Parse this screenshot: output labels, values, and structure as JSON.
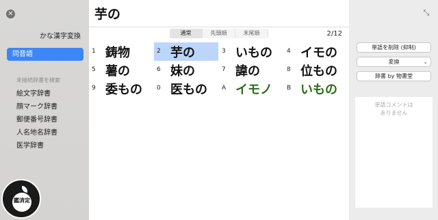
{
  "sidebar": {
    "title": "かな漢字変換",
    "selected_label": "同音語",
    "section_label": "未接続辞書を検索",
    "items": [
      {
        "label": "絵文字辞書"
      },
      {
        "label": "顔マーク辞書"
      },
      {
        "label": "郵便番号辞書"
      },
      {
        "label": "人名地名辞書"
      },
      {
        "label": "医学辞書"
      }
    ]
  },
  "header": {
    "title": "芋の"
  },
  "tabs": [
    "通常",
    "先頭順",
    "末尾順"
  ],
  "page_count": "2/12",
  "candidates": [
    [
      {
        "num": "1",
        "word": "鋳物"
      },
      {
        "num": "2",
        "word": "芋の",
        "selected": true
      },
      {
        "num": "3",
        "word": "いもの"
      },
      {
        "num": "4",
        "word": "イモの"
      }
    ],
    [
      {
        "num": "5",
        "word": "薯の"
      },
      {
        "num": "6",
        "word": "妹の"
      },
      {
        "num": "7",
        "word": "諱の"
      },
      {
        "num": "8",
        "word": "位もの"
      }
    ],
    [
      {
        "num": "9",
        "word": "委もの"
      },
      {
        "num": "0",
        "word": "医もの"
      },
      {
        "num": "A",
        "word": "イモノ",
        "color": "green"
      },
      {
        "num": "B",
        "word": "いもの",
        "color": "green"
      }
    ]
  ],
  "right_panel": {
    "delete_button": "単語を削除 (抑制)",
    "convert_select": "変換",
    "dictionary_button": "辞書 by 物書堂",
    "comment_line1": "単語コメントは",
    "comment_line2": "ありません"
  },
  "logo": {
    "text": "鑑済定"
  },
  "colors": {
    "accent": "#3d86f5",
    "selection": "#bcd6fb",
    "green_text": "#2e6b1a"
  }
}
